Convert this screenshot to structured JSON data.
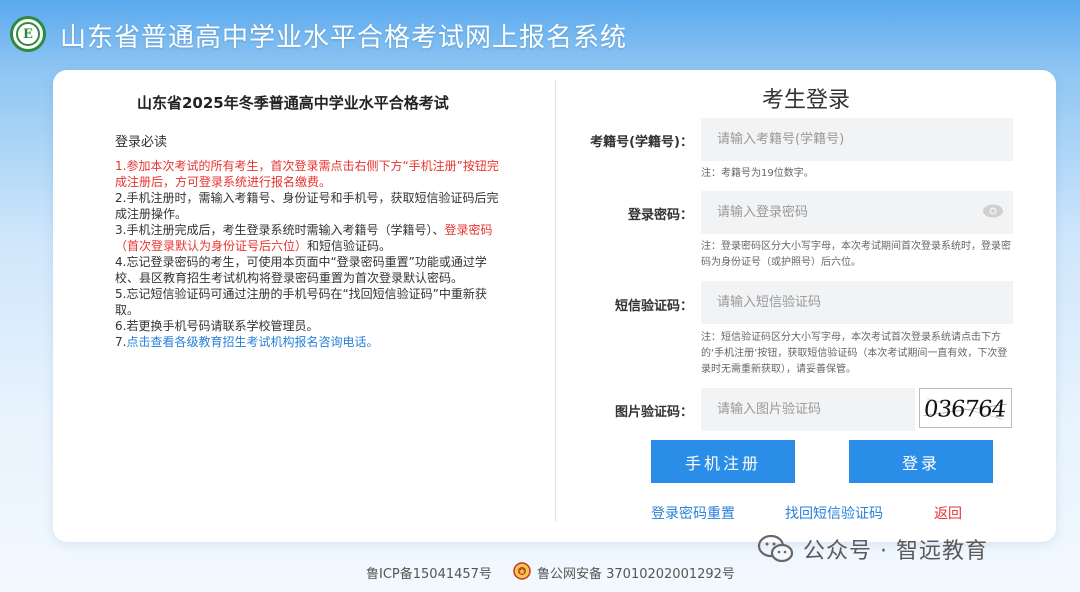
{
  "header": {
    "logo_letter": "E",
    "title": "山东省普通高中学业水平合格考试网上报名系统"
  },
  "notice": {
    "exam_title": "山东省2025年冬季普通高中学业水平合格考试",
    "heading": "登录必读",
    "item1": "1.参加本次考试的所有考生，首次登录需点击右侧下方“手机注册”按钮完成注册后，方可登录系统进行报名缴费。",
    "item2": "2.手机注册时，需输入考籍号、身份证号和手机号，获取短信验证码后完成注册操作。",
    "item3_a": "3.手机注册完成后，考生登录系统时需输入考籍号（学籍号）、",
    "item3_b": "登录密码（首次登录默认为身份证号后六位）",
    "item3_c": "和短信验证码。",
    "item4": "4.忘记登录密码的考生，可使用本页面中“登录密码重置”功能或通过学校、县区教育招生考试机构将登录密码重置为首次登录默认密码。",
    "item5": "5.忘记短信验证码可通过注册的手机号码在“找回短信验证码”中重新获取。",
    "item6": "6.若更换手机号码请联系学校管理员。",
    "item7_num": "7.",
    "item7_link": "点击查看各级教育招生考试机构报名咨询电话。"
  },
  "login": {
    "title": "考生登录",
    "exam_id": {
      "label": "考籍号(学籍号)：",
      "placeholder": "请输入考籍号(学籍号)",
      "note": "注：考籍号为19位数字。"
    },
    "password": {
      "label": "登录密码：",
      "placeholder": "请输入登录密码",
      "note": "注：登录密码区分大小写字母，本次考试期间首次登录系统时，登录密码为身份证号（或护照号）后六位。"
    },
    "sms": {
      "label": "短信验证码：",
      "placeholder": "请输入短信验证码",
      "note": "注：短信验证码区分大小写字母，本次考试首次登录系统请点击下方的‘手机注册’按钮，获取短信验证码（本次考试期间一直有效，下次登录时无需重新获取），请妥善保管。"
    },
    "captcha": {
      "label": "图片验证码：",
      "placeholder": "请输入图片验证码",
      "image_text": "036764"
    },
    "register_button": "手机注册",
    "login_button": "登录",
    "reset_link": "登录密码重置",
    "recover_link": "找回短信验证码",
    "back_link": "返回"
  },
  "footer": {
    "icp": "鲁ICP备15041457号",
    "police": "鲁公网安备 37010202001292号"
  },
  "watermark": {
    "text": "公众号 · 智远教育"
  },
  "colors": {
    "primary": "#2a8de7",
    "link_blue": "#2980d9",
    "warning_red": "#e8332f",
    "input_bg": "#f2f3f5",
    "logo_green": "#2e8b3e"
  }
}
